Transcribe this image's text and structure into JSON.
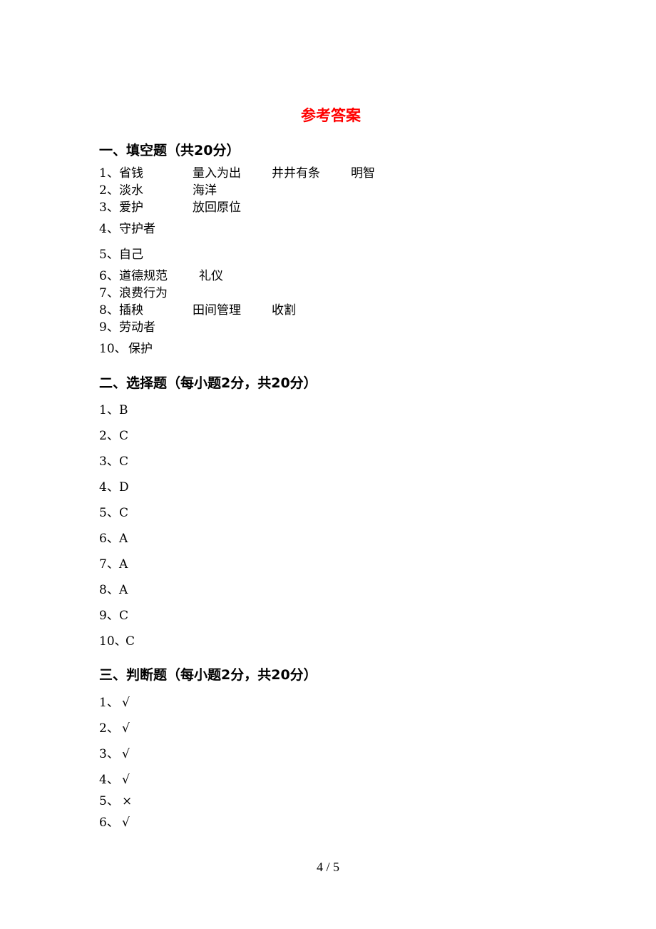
{
  "title": "参考答案",
  "sections": [
    {
      "heading": "一、填空题（共20分）",
      "items": [
        {
          "num": "1、",
          "answers": [
            "省钱",
            "量入为出",
            "井井有条",
            "明智"
          ]
        },
        {
          "num": "2、",
          "answers": [
            "淡水",
            "海洋"
          ]
        },
        {
          "num": "3、",
          "answers": [
            "爱护",
            "放回原位"
          ]
        },
        {
          "num": "4、",
          "answers": [
            "守护者"
          ]
        },
        {
          "num": "5、",
          "answers": [
            "自己"
          ]
        },
        {
          "num": "6、",
          "answers": [
            "道德规范",
            "礼仪"
          ]
        },
        {
          "num": "7、",
          "answers": [
            "浪费行为"
          ]
        },
        {
          "num": "8、",
          "answers": [
            "插秧",
            "田间管理",
            "收割"
          ]
        },
        {
          "num": "9、",
          "answers": [
            "劳动者"
          ]
        },
        {
          "num": "10、",
          "answers": [
            "保护"
          ]
        }
      ]
    },
    {
      "heading": "二、选择题（每小题2分，共20分）",
      "items": [
        {
          "num": "1、",
          "answers": [
            "B"
          ]
        },
        {
          "num": "2、",
          "answers": [
            "C"
          ]
        },
        {
          "num": "3、",
          "answers": [
            "C"
          ]
        },
        {
          "num": "4、",
          "answers": [
            "D"
          ]
        },
        {
          "num": "5、",
          "answers": [
            "C"
          ]
        },
        {
          "num": "6、",
          "answers": [
            "A"
          ]
        },
        {
          "num": "7、",
          "answers": [
            "A"
          ]
        },
        {
          "num": "8、",
          "answers": [
            "A"
          ]
        },
        {
          "num": "9、",
          "answers": [
            "C"
          ]
        },
        {
          "num": "10、",
          "answers": [
            "C"
          ]
        }
      ]
    },
    {
      "heading": "三、判断题（每小题2分，共20分）",
      "items": [
        {
          "num": "1、",
          "answers": [
            "√"
          ]
        },
        {
          "num": "2、",
          "answers": [
            "√"
          ]
        },
        {
          "num": "3、",
          "answers": [
            "√"
          ]
        },
        {
          "num": "4、",
          "answers": [
            "√"
          ]
        },
        {
          "num": "5、",
          "answers": [
            "×"
          ]
        },
        {
          "num": "6、",
          "answers": [
            "√"
          ]
        }
      ]
    }
  ],
  "page_number": "4 / 5"
}
